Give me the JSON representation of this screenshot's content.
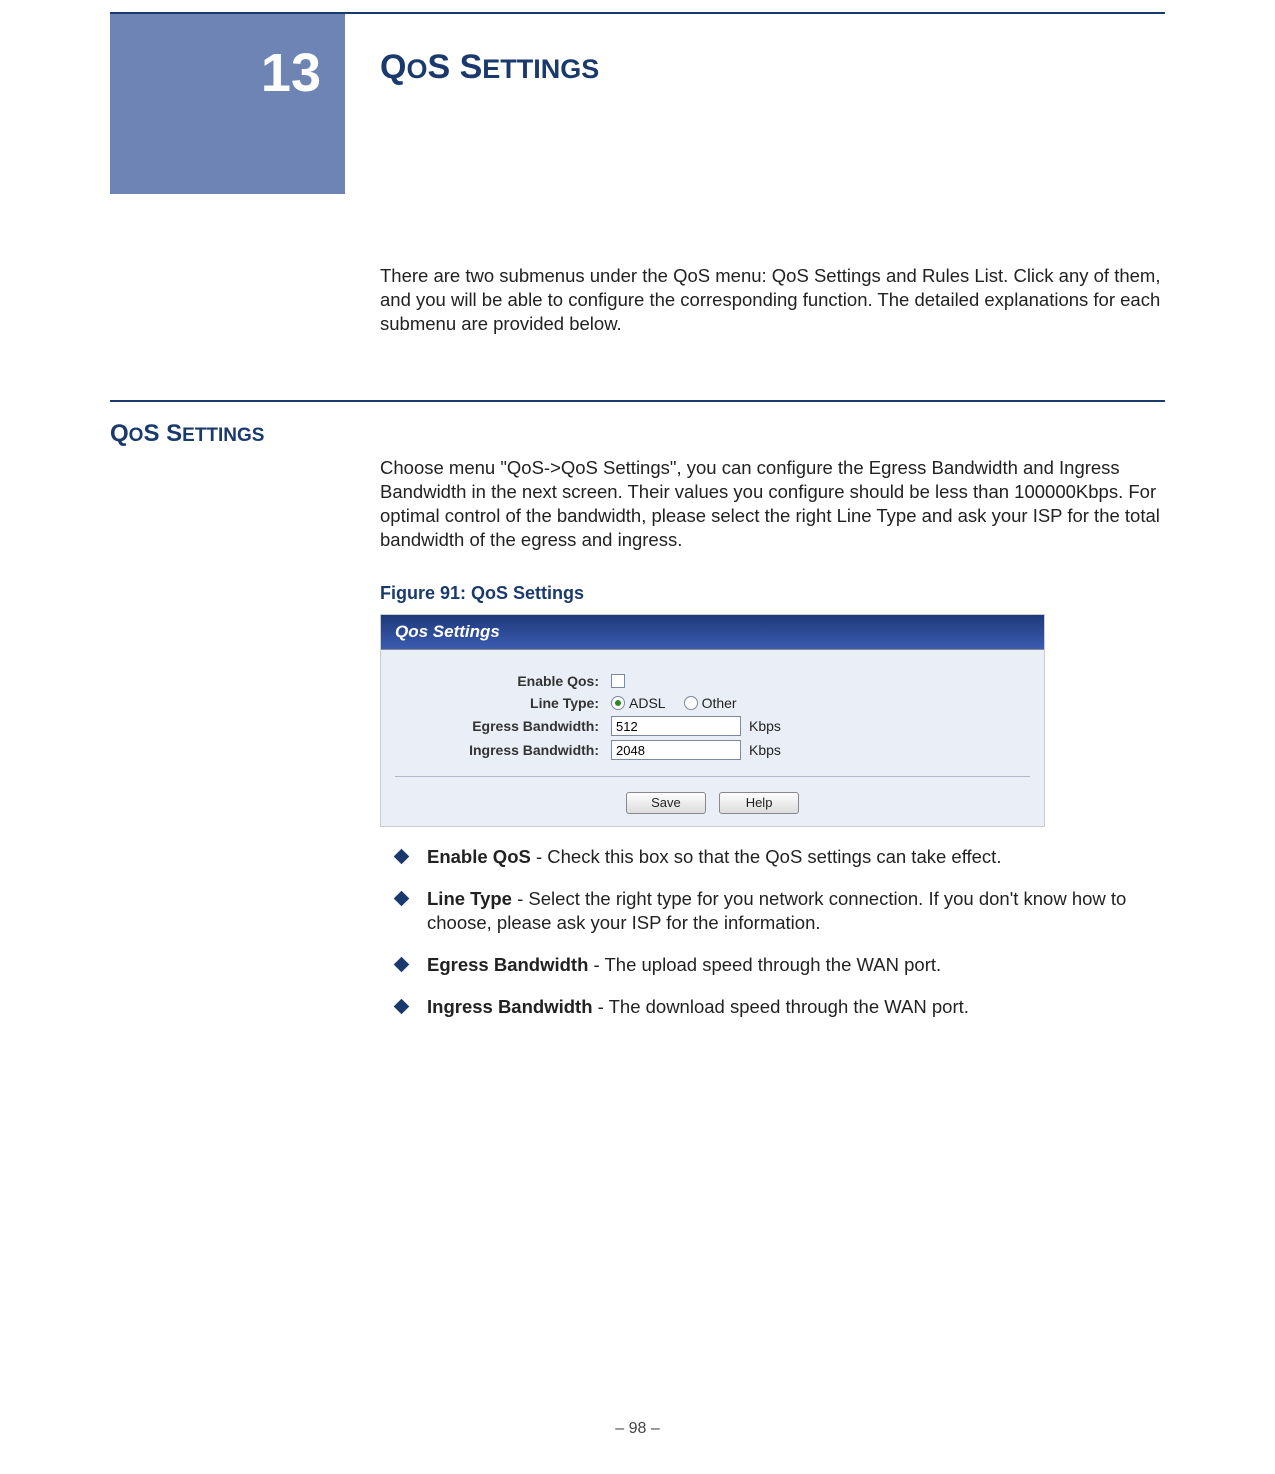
{
  "chapter": {
    "number": "13",
    "title_big1": "Q",
    "title_sm1": "O",
    "title_big2": "S S",
    "title_sm2": "ETTINGS"
  },
  "intro": "There are two submenus under the QoS menu: QoS Settings and Rules List. Click any of them, and you will be able to configure the corresponding function. The detailed explanations for each submenu are provided below.",
  "section_heading": {
    "big1": "Q",
    "sm1": "O",
    "big2": "S S",
    "sm2": "ETTINGS"
  },
  "section_body": "Choose menu \"QoS->QoS Settings\", you can configure the Egress Bandwidth and Ingress Bandwidth in the next screen. Their values you configure should be less than 100000Kbps. For optimal control of the bandwidth, please select the right Line Type and ask your ISP for the total bandwidth of the egress and ingress.",
  "figure": {
    "caption": "Figure 91:  QoS Settings",
    "panel_title": "Qos Settings",
    "labels": {
      "enable": "Enable Qos:",
      "line_type": "Line Type:",
      "egress": "Egress Bandwidth:",
      "ingress": "Ingress Bandwidth:"
    },
    "line_type_options": {
      "adsl": "ADSL",
      "other": "Other"
    },
    "values": {
      "egress": "512",
      "ingress": "2048"
    },
    "unit": "Kbps",
    "buttons": {
      "save": "Save",
      "help": "Help"
    }
  },
  "bullets": [
    {
      "bold": "Enable QoS",
      "text": " - Check this box so that the QoS settings can take effect."
    },
    {
      "bold": "Line Type",
      "text": " - Select the right type for you network connection. If you don't know how to choose, please ask your ISP for the information."
    },
    {
      "bold": "Egress Bandwidth",
      "text": " - The upload speed through the WAN port."
    },
    {
      "bold": "Ingress Bandwidth",
      "text": " - The download speed through the WAN port."
    }
  ],
  "page_number": "–  98  –"
}
